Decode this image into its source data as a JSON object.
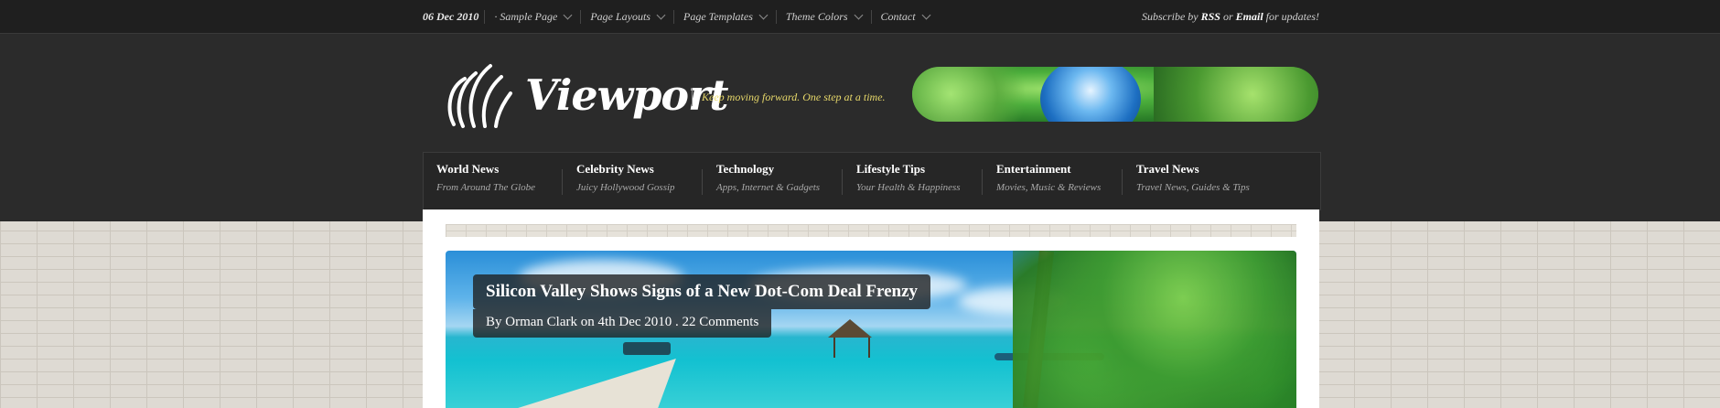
{
  "topbar": {
    "date": "06 Dec 2010",
    "nav": [
      {
        "label": "· Sample Page"
      },
      {
        "label": "Page Layouts"
      },
      {
        "label": "Page Templates"
      },
      {
        "label": "Theme Colors"
      },
      {
        "label": "Contact"
      }
    ],
    "subscribe": {
      "prefix": "Subscribe by",
      "rss": "RSS",
      "or": "or",
      "email": "Email",
      "suffix": "for updates!"
    }
  },
  "header": {
    "logo_text": "Viewport",
    "tagline": "Keep moving forward. One step at a time.",
    "banner_icon": "nature-city-banner"
  },
  "categories": [
    {
      "title": "World News",
      "subtitle": "From Around The Globe"
    },
    {
      "title": "Celebrity News",
      "subtitle": "Juicy Hollywood Gossip"
    },
    {
      "title": "Technology",
      "subtitle": "Apps, Internet & Gadgets"
    },
    {
      "title": "Lifestyle Tips",
      "subtitle": "Your Health & Happiness"
    },
    {
      "title": "Entertainment",
      "subtitle": "Movies, Music & Reviews"
    },
    {
      "title": "Travel News",
      "subtitle": "Travel News, Guides & Tips"
    }
  ],
  "feature": {
    "title": "Silicon Valley Shows Signs of a New Dot-Com Deal Frenzy",
    "meta": "By Orman Clark on 4th Dec 2010 . 22 Comments"
  },
  "colors": {
    "header_bg": "#2b2b2b",
    "topbar_bg": "#1f1f1f",
    "tagline": "#e8d96a",
    "nav_bg": "#262626"
  }
}
